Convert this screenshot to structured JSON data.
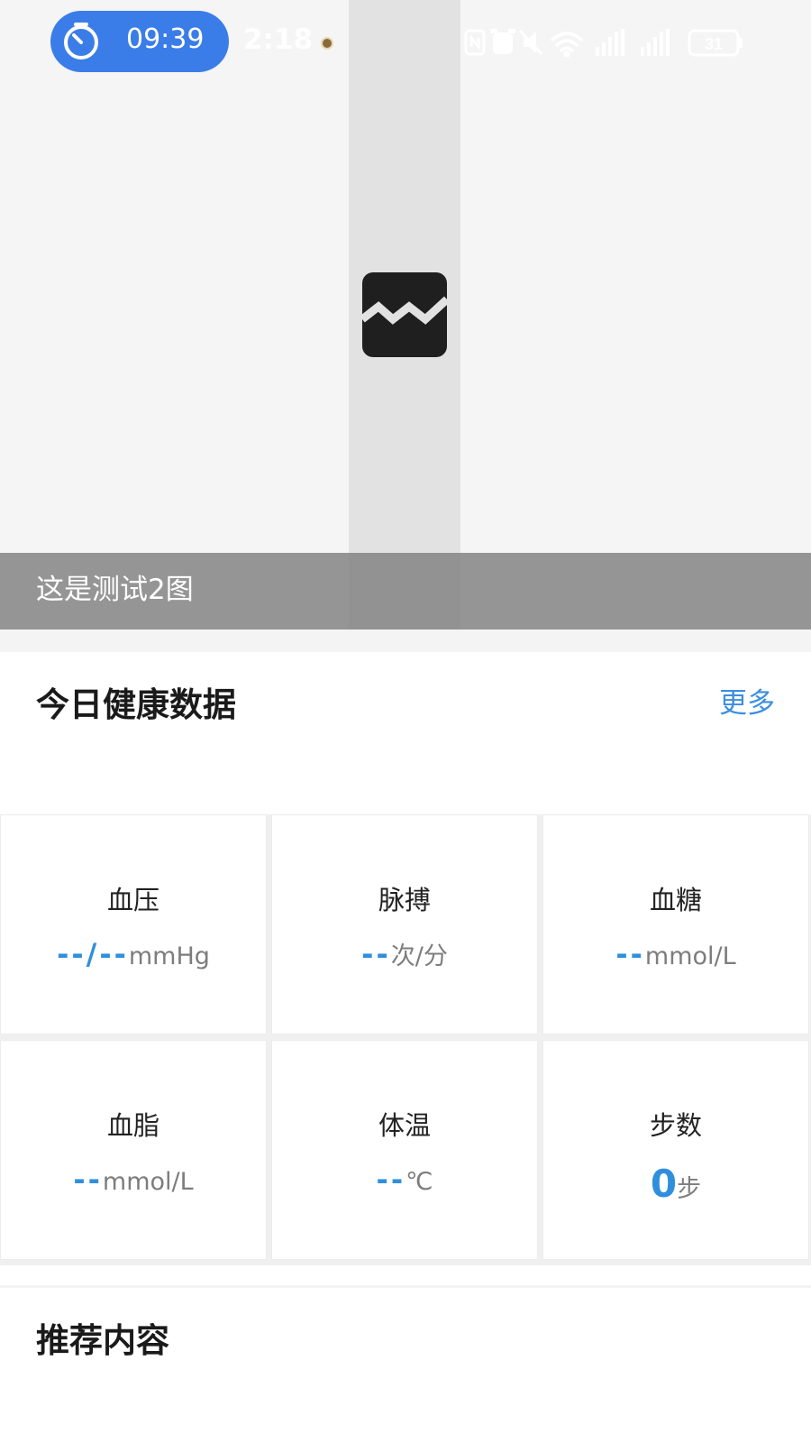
{
  "status_bar": {
    "timer": "09:39",
    "clock": "2:18",
    "battery": "31",
    "icons": [
      "nfc-icon",
      "alarm-icon",
      "mute-icon",
      "wifi-icon",
      "signal-icon",
      "signal-icon",
      "battery-icon"
    ]
  },
  "banner": {
    "caption": "这是测试2图",
    "image_icon": "broken-image-icon"
  },
  "health": {
    "title": "今日健康数据",
    "more": "更多",
    "metrics": [
      {
        "label": "血压",
        "value": "--/--",
        "unit": "mmHg"
      },
      {
        "label": "脉搏",
        "value": "--",
        "unit": "次/分"
      },
      {
        "label": "血糖",
        "value": "--",
        "unit": "mmol/L"
      },
      {
        "label": "血脂",
        "value": "--",
        "unit": "mmol/L"
      },
      {
        "label": "体温",
        "value": "--",
        "unit": "℃"
      },
      {
        "label": "步数",
        "value": "0",
        "unit": "步"
      }
    ]
  },
  "recommend": {
    "title": "推荐内容"
  },
  "colors": {
    "accent": "#2f8fdc",
    "link": "#3d8ee0",
    "timer_pill": "#3b7de8"
  }
}
